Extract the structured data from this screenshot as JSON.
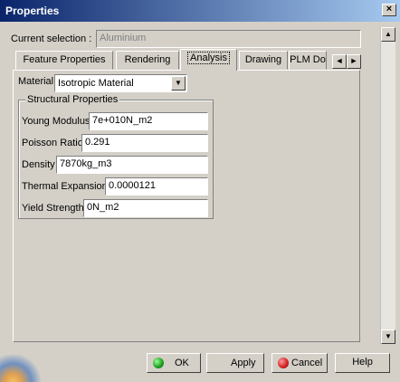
{
  "window": {
    "title": "Properties",
    "close_glyph": "×"
  },
  "current_selection": {
    "label": "Current selection :",
    "value": "Aluminium"
  },
  "tabs": [
    {
      "label": "Feature Properties"
    },
    {
      "label": "Rendering"
    },
    {
      "label": "Analysis"
    },
    {
      "label": "Drawing"
    },
    {
      "label": "PLM Do"
    }
  ],
  "tab_arrows": {
    "left": "◄",
    "right": "►"
  },
  "material": {
    "label": "Material",
    "value": "Isotropic Material"
  },
  "structural": {
    "title": "Structural Properties",
    "young": {
      "label": "Young Modulus",
      "value": "7e+010N_m2"
    },
    "poisson": {
      "label": "Poisson Ratio",
      "value": "0.291"
    },
    "density": {
      "label": "Density",
      "value": "7870kg_m3"
    },
    "thermal": {
      "label": "Thermal Expansion",
      "value": "0.0000121"
    },
    "yield": {
      "label": "Yield Strength",
      "value": "0N_m2"
    }
  },
  "scroll": {
    "up": "▲",
    "down": "▼"
  },
  "buttons": {
    "ok": "OK",
    "apply": "Apply",
    "cancel": "Cancel",
    "help": "Help"
  },
  "colors": {
    "ok": "#1a9a1a",
    "apply": "#1a8a3a",
    "cancel": "#d02020"
  }
}
